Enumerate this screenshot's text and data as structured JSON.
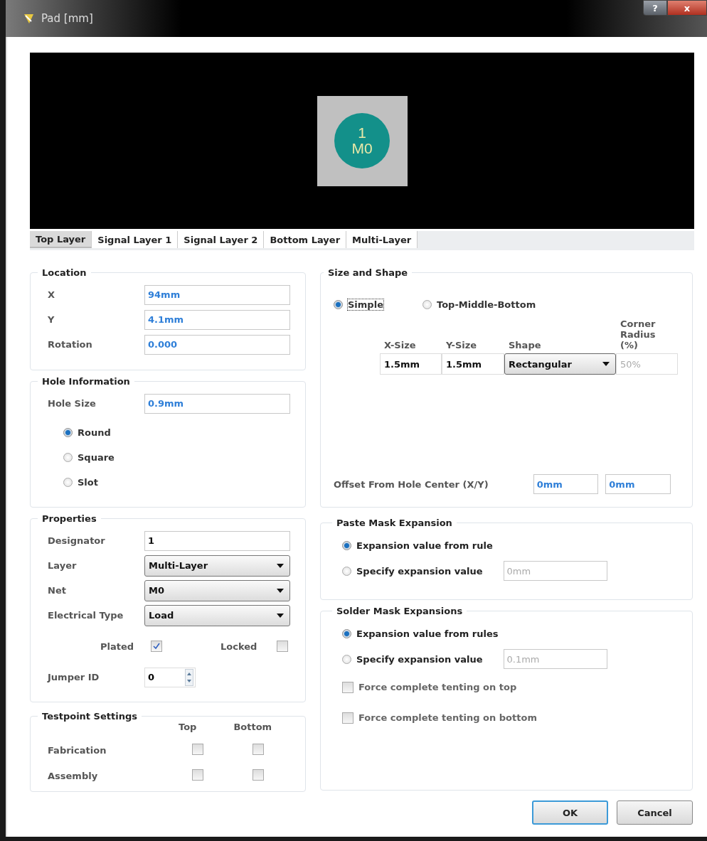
{
  "window": {
    "title": "Pad [mm]",
    "help_button": "?",
    "close_button": "x"
  },
  "preview": {
    "pad_number": "1",
    "pad_net": "M0"
  },
  "tabs": [
    {
      "label": "Top Layer",
      "selected": true
    },
    {
      "label": "Signal Layer 1",
      "selected": false
    },
    {
      "label": "Signal Layer 2",
      "selected": false
    },
    {
      "label": "Bottom Layer",
      "selected": false
    },
    {
      "label": "Multi-Layer",
      "selected": false
    }
  ],
  "location": {
    "title": "Location",
    "rows": [
      {
        "label": "X",
        "value": "94mm"
      },
      {
        "label": "Y",
        "value": "4.1mm"
      },
      {
        "label": "Rotation",
        "value": "0.000"
      }
    ]
  },
  "hole_information": {
    "title": "Hole Information",
    "hole_size": {
      "label": "Hole Size",
      "value": "0.9mm"
    },
    "shapes": [
      {
        "label": "Round",
        "selected": true
      },
      {
        "label": "Square",
        "selected": false
      },
      {
        "label": "Slot",
        "selected": false
      }
    ]
  },
  "properties": {
    "title": "Properties",
    "designator": {
      "label": "Designator",
      "value": "1"
    },
    "dropdowns": [
      {
        "label": "Layer",
        "value": "Multi-Layer"
      },
      {
        "label": "Net",
        "value": "M0"
      },
      {
        "label": "Electrical Type",
        "value": "Load"
      }
    ],
    "plated": {
      "label": "Plated",
      "checked": true
    },
    "locked": {
      "label": "Locked",
      "checked": false
    },
    "jumper_id": {
      "label": "Jumper ID",
      "value": "0"
    }
  },
  "testpoint_settings": {
    "title": "Testpoint Settings",
    "columns": [
      "Top",
      "Bottom"
    ],
    "rows": [
      {
        "label": "Fabrication",
        "top": false,
        "bottom": false
      },
      {
        "label": "Assembly",
        "top": false,
        "bottom": false
      }
    ]
  },
  "size_and_shape": {
    "title": "Size and Shape",
    "modes": [
      {
        "label": "Simple",
        "selected": true,
        "focused": true
      },
      {
        "label": "Top-Middle-Bottom",
        "selected": false,
        "focused": false
      }
    ],
    "columns": [
      "X-Size",
      "Y-Size",
      "Shape",
      "Corner Radius (%)"
    ],
    "row": {
      "x_size": "1.5mm",
      "y_size": "1.5mm",
      "shape": "Rectangular",
      "corner_radius": "50%",
      "corner_radius_disabled": true
    },
    "offset": {
      "label": "Offset From Hole Center (X/Y)",
      "x": "0mm",
      "y": "0mm"
    }
  },
  "paste_mask_expansion": {
    "title": "Paste Mask Expansion",
    "options": [
      {
        "label": "Expansion value from rule",
        "selected": true
      },
      {
        "label": "Specify expansion value",
        "selected": false,
        "value": "0mm",
        "disabled": true
      }
    ]
  },
  "solder_mask_expansions": {
    "title": "Solder Mask Expansions",
    "options": [
      {
        "label": "Expansion value from rules",
        "selected": true
      },
      {
        "label": "Specify expansion value",
        "selected": false,
        "value": "0.1mm",
        "disabled": true
      }
    ],
    "checkboxes": [
      {
        "label": "Force complete tenting on top",
        "checked": false
      },
      {
        "label": "Force complete tenting on bottom",
        "checked": false
      }
    ]
  },
  "buttons": [
    {
      "label": "OK",
      "default": true
    },
    {
      "label": "Cancel",
      "default": false
    }
  ]
}
